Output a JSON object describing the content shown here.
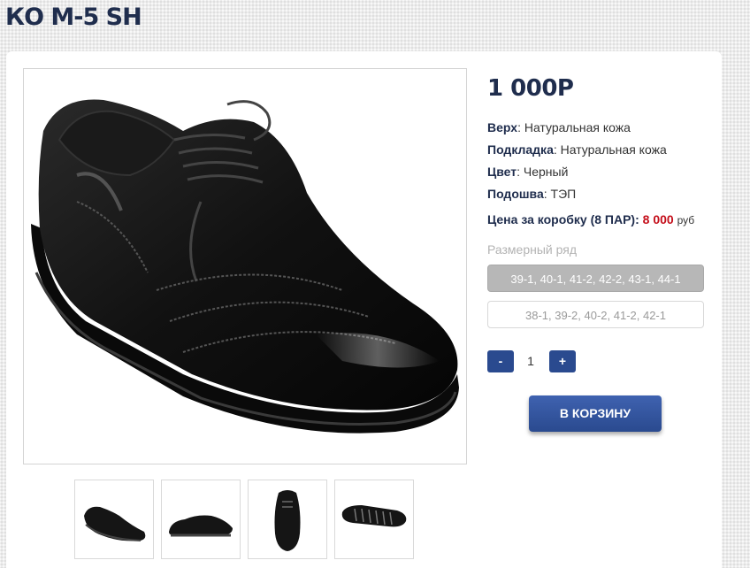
{
  "product": {
    "title": "КО М-5 SH",
    "price": "1 000Р"
  },
  "specs": [
    {
      "label": "Верх",
      "value": ": Натуральная кожа"
    },
    {
      "label": "Подкладка",
      "value": ": Натуральная кожа"
    },
    {
      "label": "Цвет",
      "value": ": Черный"
    },
    {
      "label": "Подошва",
      "value": ": ТЭП"
    }
  ],
  "box_price": {
    "label": "Цена за коробку (8 ПАР):",
    "value": "8 000",
    "currency": "руб"
  },
  "sizes": {
    "label": "Размерный ряд",
    "options": [
      {
        "text": "39-1, 40-1, 41-2, 42-2, 43-1, 44-1",
        "selected": true
      },
      {
        "text": "38-1, 39-2, 40-2, 41-2, 42-1",
        "selected": false
      }
    ]
  },
  "quantity": {
    "minus": "-",
    "value": "1",
    "plus": "+"
  },
  "cart_button": "В КОРЗИНУ",
  "colors": {
    "brand_navy": "#1f2d4d",
    "button_blue": "#2a4a8f",
    "price_red": "#c40e1a"
  }
}
